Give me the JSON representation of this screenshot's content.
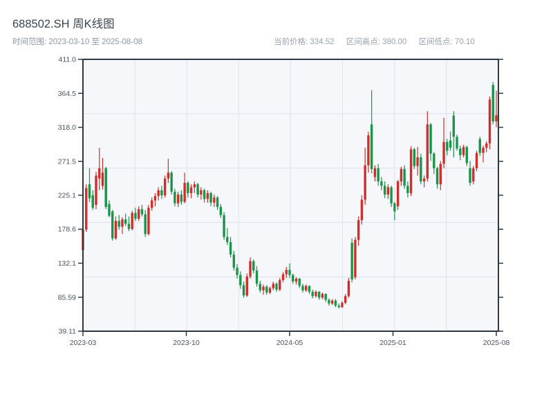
{
  "header": {
    "title": "688502.SH 周K线图",
    "subtitle": "时间范围: 2023-03-10 至 2025-08-08",
    "stats": [
      {
        "label": "当前价格",
        "value": "334.52"
      },
      {
        "label": "区间高点",
        "value": "380.00"
      },
      {
        "label": "区间低点",
        "value": "70.10"
      }
    ]
  },
  "colors": {
    "up": "#cf2e2a",
    "down": "#1b9449",
    "plot_bg": "#f5f7fa",
    "grid": "#dde1ea",
    "spine": "#2d3845",
    "tick_label": "#4a545f"
  },
  "chart_data": {
    "type": "candlestick",
    "title": "688502.SH 周K线图",
    "symbol": "688502.SH",
    "period": "weekly",
    "date_range_start": "2023-03-10",
    "date_range_end": "2025-08-08",
    "current_price": 334.52,
    "range_high": 380.0,
    "range_low": 70.1,
    "ylim": [
      39.11,
      411.0
    ],
    "y_ticks": [
      "411.0",
      "364.5",
      "318.0",
      "271.5",
      "225.1",
      "178.6",
      "132.1",
      "85.59",
      "39.11"
    ],
    "y_tick_values": [
      411.0,
      364.5,
      318.0,
      271.5,
      225.1,
      178.6,
      132.1,
      85.59,
      39.11
    ],
    "x_ticks": [
      "2023-03",
      "2023-10",
      "2024-05",
      "2025-01",
      "2025-08"
    ],
    "grid": {
      "columns": 8,
      "rows": 5,
      "grid_on": true
    },
    "legend_position": "none",
    "candles_format": [
      "open",
      "high",
      "low",
      "close"
    ],
    "candles": [
      [
        150,
        182,
        148,
        178
      ],
      [
        178,
        240,
        175,
        235
      ],
      [
        240,
        262,
        216,
        221
      ],
      [
        225,
        232,
        205,
        208
      ],
      [
        212,
        257,
        206,
        252
      ],
      [
        248,
        290,
        232,
        262
      ],
      [
        238,
        276,
        233,
        256
      ],
      [
        262,
        264,
        206,
        209
      ],
      [
        213,
        218,
        195,
        197
      ],
      [
        203,
        205,
        163,
        166
      ],
      [
        166,
        196,
        164,
        190
      ],
      [
        190,
        198,
        178,
        182
      ],
      [
        182,
        195,
        172,
        192
      ],
      [
        192,
        200,
        183,
        186
      ],
      [
        186,
        196,
        176,
        179
      ],
      [
        179,
        204,
        177,
        201
      ],
      [
        201,
        208,
        190,
        193
      ],
      [
        193,
        210,
        190,
        206
      ],
      [
        206,
        212,
        196,
        199
      ],
      [
        199,
        205,
        168,
        172
      ],
      [
        172,
        212,
        170,
        208
      ],
      [
        208,
        222,
        204,
        218
      ],
      [
        218,
        228,
        210,
        224
      ],
      [
        224,
        236,
        218,
        232
      ],
      [
        232,
        238,
        220,
        225
      ],
      [
        225,
        252,
        222,
        248
      ],
      [
        248,
        275,
        242,
        256
      ],
      [
        256,
        258,
        226,
        230
      ],
      [
        230,
        234,
        210,
        214
      ],
      [
        214,
        230,
        209,
        226
      ],
      [
        226,
        232,
        212,
        216
      ],
      [
        216,
        256,
        214,
        242
      ],
      [
        242,
        244,
        222,
        228
      ],
      [
        228,
        240,
        221,
        236
      ],
      [
        236,
        244,
        228,
        240
      ],
      [
        240,
        242,
        222,
        226
      ],
      [
        226,
        236,
        219,
        232
      ],
      [
        232,
        234,
        215,
        220
      ],
      [
        220,
        232,
        215,
        228
      ],
      [
        228,
        230,
        210,
        215
      ],
      [
        215,
        226,
        209,
        222
      ],
      [
        222,
        224,
        205,
        209
      ],
      [
        209,
        213,
        194,
        198
      ],
      [
        198,
        202,
        164,
        168
      ],
      [
        168,
        180,
        157,
        161
      ],
      [
        161,
        168,
        140,
        144
      ],
      [
        144,
        149,
        122,
        126
      ],
      [
        126,
        131,
        111,
        116
      ],
      [
        116,
        121,
        97,
        102
      ],
      [
        102,
        107,
        85,
        88
      ],
      [
        88,
        118,
        86,
        114
      ],
      [
        114,
        140,
        111,
        135
      ],
      [
        135,
        137,
        118,
        122
      ],
      [
        122,
        128,
        100,
        104
      ],
      [
        104,
        108,
        92,
        95
      ],
      [
        95,
        103,
        89,
        100
      ],
      [
        100,
        102,
        89,
        92
      ],
      [
        92,
        100,
        90,
        98
      ],
      [
        98,
        107,
        95,
        104
      ],
      [
        104,
        106,
        93,
        96
      ],
      [
        96,
        112,
        94,
        109
      ],
      [
        109,
        120,
        106,
        117
      ],
      [
        117,
        127,
        112,
        123
      ],
      [
        123,
        132,
        112,
        116
      ],
      [
        116,
        118,
        104,
        107
      ],
      [
        107,
        113,
        103,
        111
      ],
      [
        111,
        112,
        98,
        101
      ],
      [
        101,
        104,
        92,
        95
      ],
      [
        95,
        103,
        93,
        101
      ],
      [
        101,
        102,
        90,
        93
      ],
      [
        93,
        96,
        84,
        87
      ],
      [
        87,
        95,
        85,
        93
      ],
      [
        93,
        94,
        82,
        85
      ],
      [
        85,
        92,
        83,
        90
      ],
      [
        90,
        91,
        79,
        82
      ],
      [
        82,
        84,
        74,
        77
      ],
      [
        77,
        83,
        75,
        81
      ],
      [
        81,
        83,
        72,
        74
      ],
      [
        74,
        77,
        70.1,
        72
      ],
      [
        72,
        80,
        71,
        78
      ],
      [
        78,
        90,
        76,
        87
      ],
      [
        87,
        112,
        85,
        108
      ],
      [
        160,
        166,
        106,
        110
      ],
      [
        113,
        168,
        110,
        164
      ],
      [
        164,
        196,
        156,
        191
      ],
      [
        191,
        225,
        185,
        219
      ],
      [
        219,
        290,
        212,
        266
      ],
      [
        266,
        312,
        256,
        307
      ],
      [
        322,
        369,
        255,
        261
      ],
      [
        250,
        266,
        244,
        262
      ],
      [
        262,
        268,
        238,
        244
      ],
      [
        244,
        250,
        232,
        238
      ],
      [
        238,
        244,
        221,
        226
      ],
      [
        226,
        240,
        220,
        236
      ],
      [
        236,
        238,
        209,
        214
      ],
      [
        214,
        216,
        191,
        203
      ],
      [
        210,
        246,
        205,
        244
      ],
      [
        244,
        264,
        238,
        261
      ],
      [
        261,
        266,
        234,
        238
      ],
      [
        238,
        244,
        222,
        228
      ],
      [
        228,
        292,
        224,
        288
      ],
      [
        288,
        290,
        261,
        265
      ],
      [
        265,
        291,
        252,
        277
      ],
      [
        277,
        282,
        240,
        244
      ],
      [
        244,
        252,
        236,
        248
      ],
      [
        248,
        340,
        244,
        322
      ],
      [
        322,
        324,
        272,
        282
      ],
      [
        282,
        284,
        254,
        262
      ],
      [
        262,
        264,
        234,
        240
      ],
      [
        240,
        272,
        232,
        268
      ],
      [
        268,
        331,
        262,
        298
      ],
      [
        298,
        302,
        280,
        286
      ],
      [
        300,
        312,
        286,
        290
      ],
      [
        334,
        340,
        277,
        305
      ],
      [
        305,
        308,
        286,
        289
      ],
      [
        289,
        293,
        273,
        280
      ],
      [
        280,
        294,
        277,
        291
      ],
      [
        291,
        293,
        265,
        269
      ],
      [
        262,
        272,
        238,
        242
      ],
      [
        244,
        265,
        240,
        262
      ],
      [
        262,
        286,
        258,
        283
      ],
      [
        302,
        305,
        279,
        283
      ],
      [
        283,
        293,
        270,
        290
      ],
      [
        290,
        299,
        284,
        296
      ],
      [
        296,
        360,
        288,
        356
      ],
      [
        376,
        380,
        322,
        326
      ],
      [
        326,
        368,
        318,
        334.52
      ]
    ]
  }
}
